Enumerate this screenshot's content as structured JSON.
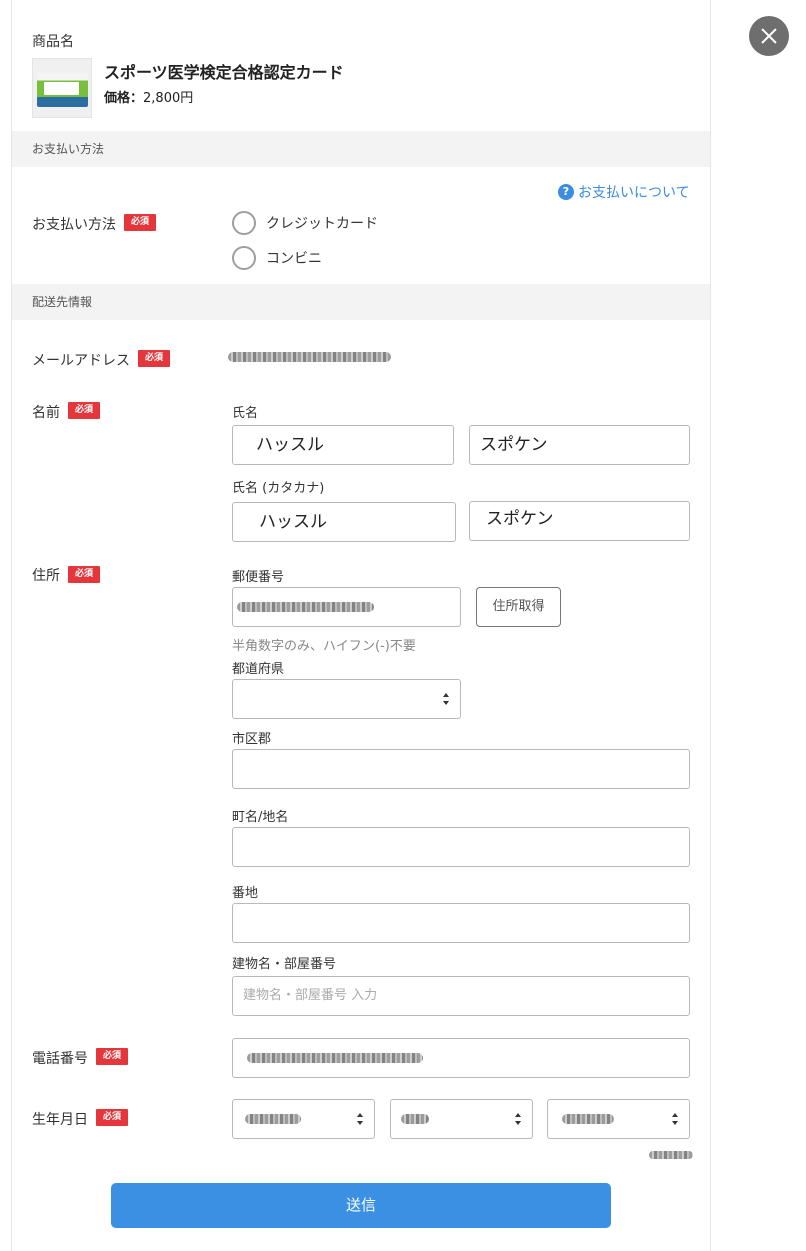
{
  "product": {
    "heading": "商品名",
    "name": "スポーツ医学検定合格認定カード",
    "price_label": "価格：",
    "price_value": "2,800円"
  },
  "payment_section": {
    "title": "お支払い方法",
    "help_link": "お支払いについて",
    "method_label": "お支払い方法",
    "options": [
      "クレジットカード",
      "コンビニ"
    ]
  },
  "required_badge": "必須",
  "shipping_section": {
    "title": "配送先情報",
    "email_label": "メールアドレス",
    "name_label": "名前",
    "full_name_label": "氏名",
    "last_name": "ハッスル",
    "first_name": "スポケン",
    "kana_label": "氏名 (カタカナ)",
    "last_name_kana": "ハッスル",
    "first_name_kana": "スポケン",
    "address_label": "住所",
    "postal_label": "郵便番号",
    "address_lookup_button": "住所取得",
    "postal_hint": "半角数字のみ、ハイフン(-)不要",
    "prefecture_label": "都道府県",
    "city_label": "市区郡",
    "town_label": "町名/地名",
    "street_label": "番地",
    "building_label": "建物名・部屋番号",
    "building_placeholder": "建物名・部屋番号 入力",
    "phone_label": "電話番号",
    "birthday_label": "生年月日"
  },
  "submit_label": "送信",
  "icons": {
    "close": "close-icon",
    "help": "help-icon",
    "select": "chevron-updown-icon"
  },
  "colors": {
    "required_badge": "#e5373b",
    "submit_button": "#3b90e4",
    "link": "#3b8de0",
    "section_bg": "#f3f3f3"
  }
}
